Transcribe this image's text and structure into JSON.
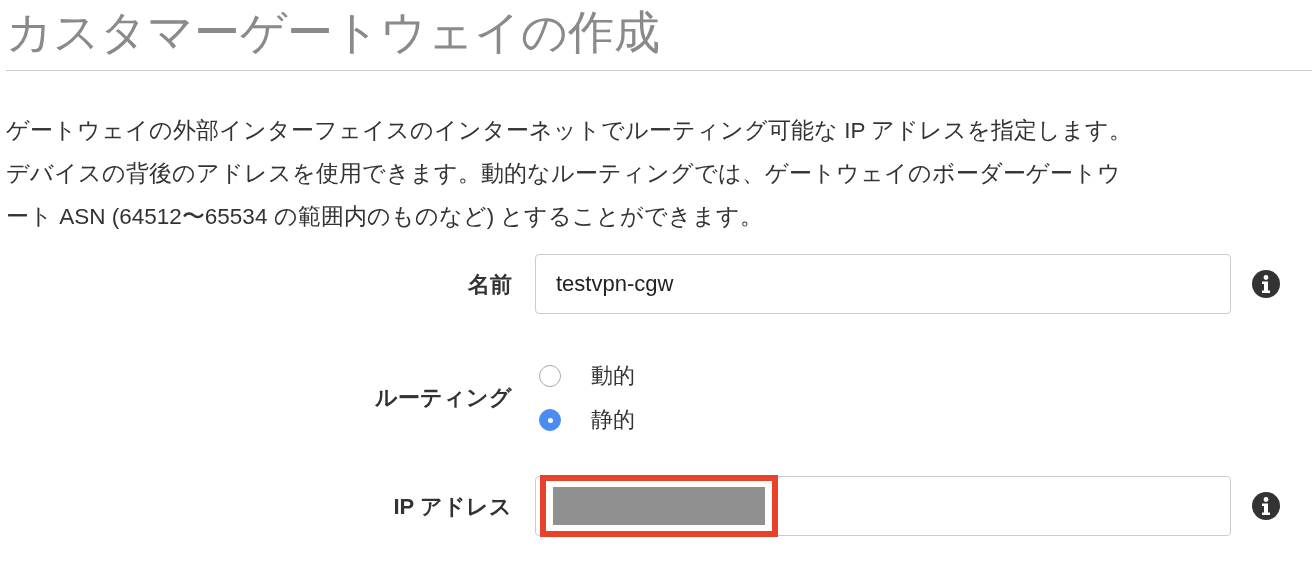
{
  "title": "カスタマーゲートウェイの作成",
  "description_lines": [
    "ゲートウェイの外部インターフェイスのインターネットでルーティング可能な IP アドレスを指定します。",
    "デバイスの背後のアドレスを使用できます。動的なルーティングでは、ゲートウェイのボーダーゲートウ",
    "ート ASN (64512〜65534 の範囲内のものなど) とすることができます。"
  ],
  "fields": [
    {
      "kind": "text",
      "label": "名前",
      "value": "testvpn-cgw",
      "info": true
    },
    {
      "kind": "radio",
      "label": "ルーティング",
      "options": [
        {
          "label": "動的",
          "selected": false
        },
        {
          "label": "静的",
          "selected": true
        }
      ]
    },
    {
      "kind": "text",
      "label": "IP アドレス",
      "value_masked": true,
      "highlighted": true,
      "info": true
    }
  ]
}
